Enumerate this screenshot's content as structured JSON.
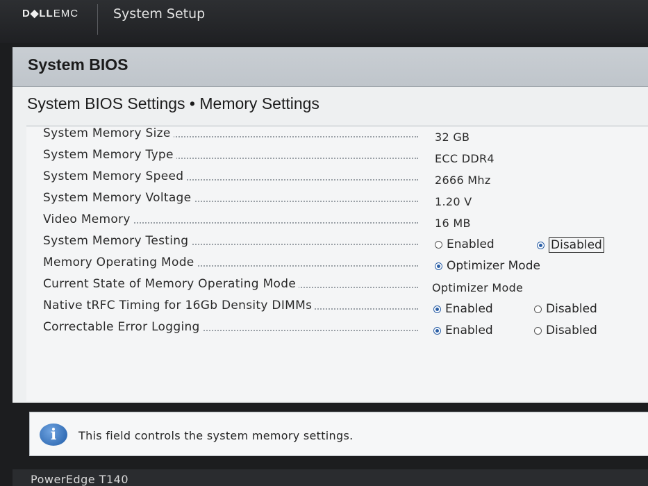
{
  "header": {
    "brand_bold": "D◆LL",
    "brand_rest": "EMC",
    "app_title": "System Setup"
  },
  "panel": {
    "title": "System BIOS",
    "section_title": "System BIOS Settings • Memory Settings"
  },
  "settings": [
    {
      "label": "System Memory Size",
      "value": "32 GB"
    },
    {
      "label": "System Memory Type",
      "value": "ECC DDR4"
    },
    {
      "label": "System Memory Speed",
      "value": "2666 Mhz"
    },
    {
      "label": "System Memory Voltage",
      "value": "1.20 V"
    },
    {
      "label": "Video Memory",
      "value": "16 MB"
    },
    {
      "label": "System Memory Testing",
      "options": [
        {
          "text": "Enabled",
          "selected": false
        },
        {
          "text": "Disabled",
          "selected": true
        }
      ]
    },
    {
      "label": "Memory Operating Mode",
      "options": [
        {
          "text": "Optimizer Mode",
          "selected": true
        }
      ]
    },
    {
      "label": "Current State of Memory Operating Mode",
      "value": "Optimizer Mode"
    },
    {
      "label": "Native tRFC Timing for 16Gb Density DIMMs",
      "options": [
        {
          "text": "Enabled",
          "selected": true
        },
        {
          "text": "Disabled",
          "selected": false
        }
      ]
    },
    {
      "label": "Correctable Error Logging",
      "options": [
        {
          "text": "Enabled",
          "selected": true
        },
        {
          "text": "Disabled",
          "selected": false
        }
      ]
    }
  ],
  "help": {
    "icon": "info-icon",
    "text": "This field controls the system memory settings."
  },
  "footer": {
    "model": "PowerEdge T140"
  },
  "colors": {
    "accent_radio": "#2b5fa6",
    "header_bg": "#2d2f32",
    "panel_header_bg": "#c9ced3"
  }
}
